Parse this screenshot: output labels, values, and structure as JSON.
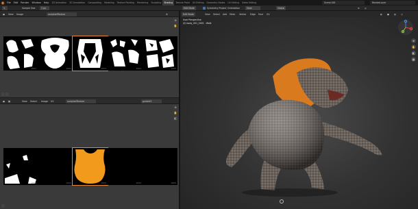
{
  "app": {
    "menu": [
      "File",
      "Edit",
      "Render",
      "Window",
      "Help"
    ],
    "workspaces": [
      "2D Animation",
      "2D Annotation",
      "Compositing",
      "Modeling",
      "Texture Painting",
      "Rendering",
      "Sculpting",
      "Shading",
      "Texture Paint",
      "UV Editing",
      "Geometry Nodes",
      "UV Editing",
      "Video Editing"
    ],
    "active_workspace": "Shading",
    "scene": "Scene.001",
    "view_layer": "RenderLayer"
  },
  "toolbar": {
    "sample_size_label": "Sample Size",
    "sample_size_value": "1 px",
    "edit_mode": "Edit Mode",
    "view": "View",
    "select": "Select",
    "add": "Add",
    "mesh": "Mesh",
    "vertex": "Vertex",
    "edge": "Edge",
    "face": "Face",
    "uv": "UV",
    "orientation_label": "Orientation",
    "orientation_value": "View",
    "symmetry_label": "Symmetry Project",
    "global": "Global"
  },
  "image_editor_top": {
    "view": "View",
    "image": "Image",
    "image_name": "sculptedTexture",
    "tiles": [
      "1001",
      "1002",
      "1003",
      "1004",
      "1005"
    ]
  },
  "image_editor_bottom": {
    "view": "View",
    "select": "Select",
    "image": "Image",
    "uv": "UV",
    "image_name": "sculptedTexture",
    "uv_map": "guideUV",
    "tiles": [
      "1001",
      "1002",
      "1003",
      "1004",
      "1005"
    ]
  },
  "viewport": {
    "mode": "Edit Mode",
    "view": "View",
    "select": "Select",
    "add": "Add",
    "mesh": "Mesh",
    "vertex": "Vertex",
    "edge": "Edge",
    "face": "Face",
    "uv": "UV",
    "perspective_label": "User Perspective",
    "object_label": "(0) body_001_0001 : Walk",
    "gizmo": {
      "x": "X",
      "y": "Y",
      "z": "Z"
    }
  },
  "colors": {
    "accent": "#e8873a",
    "selection": "#f29a1c"
  }
}
